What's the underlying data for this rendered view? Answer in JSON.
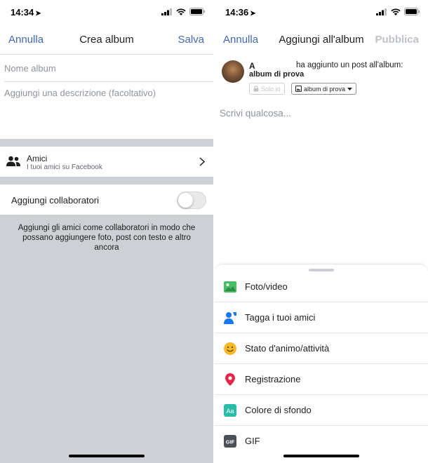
{
  "left": {
    "status": {
      "time": "14:34"
    },
    "nav": {
      "cancel": "Annulla",
      "title": "Crea album",
      "save": "Salva"
    },
    "form": {
      "name_placeholder": "Nome album",
      "description_placeholder": "Aggiungi una descrizione (facoltativo)"
    },
    "privacy": {
      "title": "Amici",
      "subtitle": "I tuoi amici su Facebook"
    },
    "collaborators": {
      "label": "Aggiungi collaboratori",
      "toggle_on": false,
      "help": "Aggiungi gli amici come collaboratori in modo che possano aggiungere foto, post con testo e altro ancora"
    }
  },
  "right": {
    "status": {
      "time": "14:36"
    },
    "nav": {
      "cancel": "Annulla",
      "title": "Aggiungi all'album",
      "publish": "Pubblica"
    },
    "post": {
      "author": "A",
      "action": "ha aggiunto un post all'album:",
      "album": "album di prova",
      "privacy_chip": "Solo io",
      "album_chip": "album di prova",
      "compose_placeholder": "Scrivi qualcosa..."
    },
    "options": [
      {
        "label": "Foto/video",
        "icon": "photo-icon",
        "color": "#45bd62"
      },
      {
        "label": "Tagga i tuoi amici",
        "icon": "tag-friends-icon",
        "color": "#1877f2"
      },
      {
        "label": "Stato d'animo/attività",
        "icon": "emoji-icon",
        "color": "#f7b928"
      },
      {
        "label": "Registrazione",
        "icon": "location-pin-icon",
        "color": "#e42645"
      },
      {
        "label": "Colore di sfondo",
        "icon": "text-background-icon",
        "color": "#2abba7"
      },
      {
        "label": "GIF",
        "icon": "gif-icon",
        "color": "#4b4f56"
      }
    ]
  },
  "colors": {
    "accent": "#4267b2",
    "muted": "#8d949e",
    "gray_bg": "#cdd0d5"
  }
}
